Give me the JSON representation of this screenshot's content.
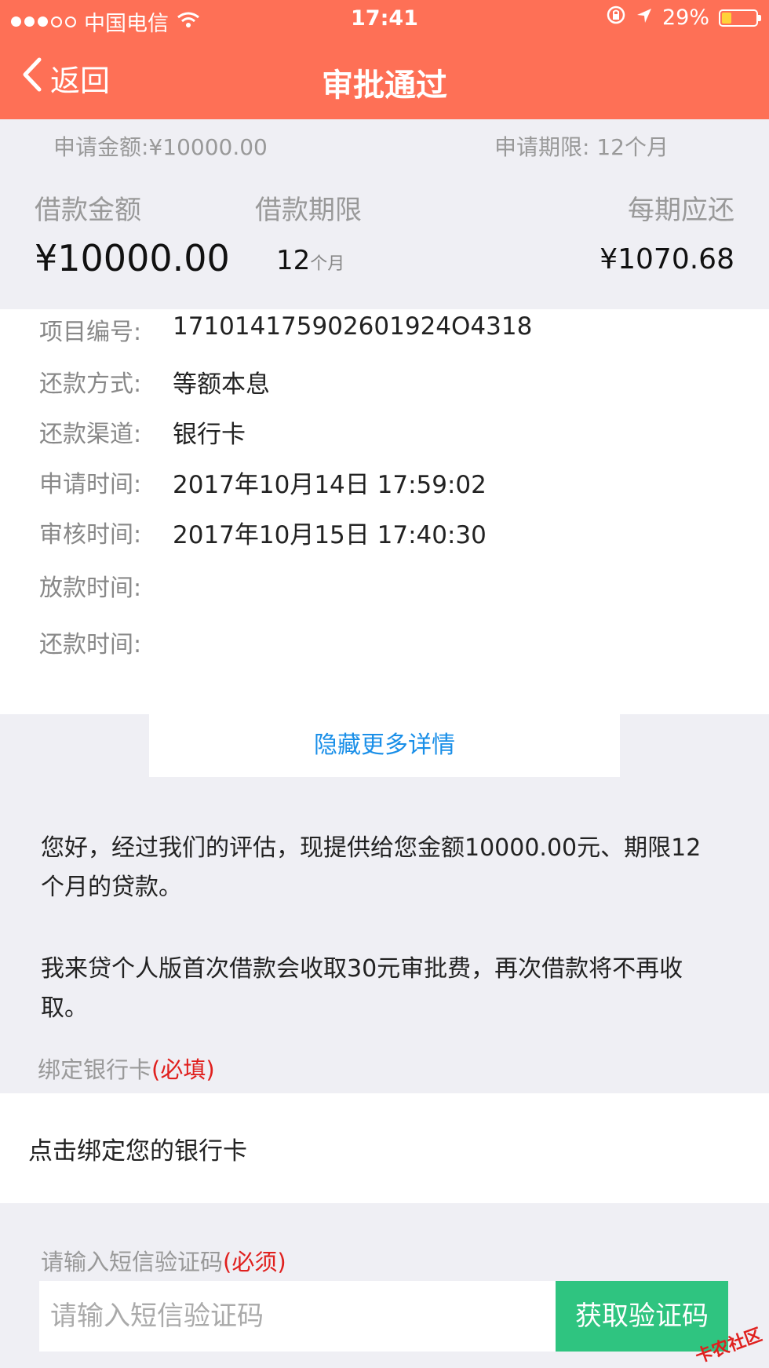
{
  "statusbar": {
    "carrier": "中国电信",
    "time": "17:41",
    "battery_text": "29%",
    "battery_level": 0.29
  },
  "nav": {
    "back_label": "返回",
    "title": "审批通过"
  },
  "summary": {
    "apply_amount": "申请金额:¥10000.00",
    "apply_term": "申请期限: 12个月",
    "loan_amount_label": "借款金额",
    "loan_term_label": "借款期限",
    "per_period_label": "每期应还",
    "loan_amount_value": "¥10000.00",
    "loan_term_value": "12",
    "loan_term_unit": "个月",
    "per_period_value": "¥1070.68"
  },
  "details": {
    "rows": [
      {
        "label": "项目编号:",
        "value": "171014175902601924O4318"
      },
      {
        "label": "还款方式:",
        "value": "等额本息"
      },
      {
        "label": "还款渠道:",
        "value": "银行卡"
      },
      {
        "label": "申请时间:",
        "value": "2017年10月14日 17:59:02"
      },
      {
        "label": "审核时间:",
        "value": "2017年10月15日 17:40:30"
      },
      {
        "label": "放款时间:",
        "value": ""
      },
      {
        "label": "还款时间:",
        "value": ""
      }
    ],
    "toggle_label": "隐藏更多详情"
  },
  "messages": {
    "offer": "您好，经过我们的评估，现提供给您金额10000.00元、期限12个月的贷款。",
    "fee": "我来贷个人版首次借款会收取30元审批费，再次借款将不再收取。"
  },
  "bind_card": {
    "label": "绑定银行卡",
    "required": "(必填)",
    "action": "点击绑定您的银行卡"
  },
  "sms": {
    "label": "请输入短信验证码",
    "required": "(必须)",
    "placeholder": "请输入短信验证码",
    "button": "获取验证码"
  },
  "watermark": "卡农社区",
  "colors": {
    "header": "#fe7056",
    "link": "#1a8fe8",
    "required": "#e0201e",
    "button": "#2fc480"
  }
}
